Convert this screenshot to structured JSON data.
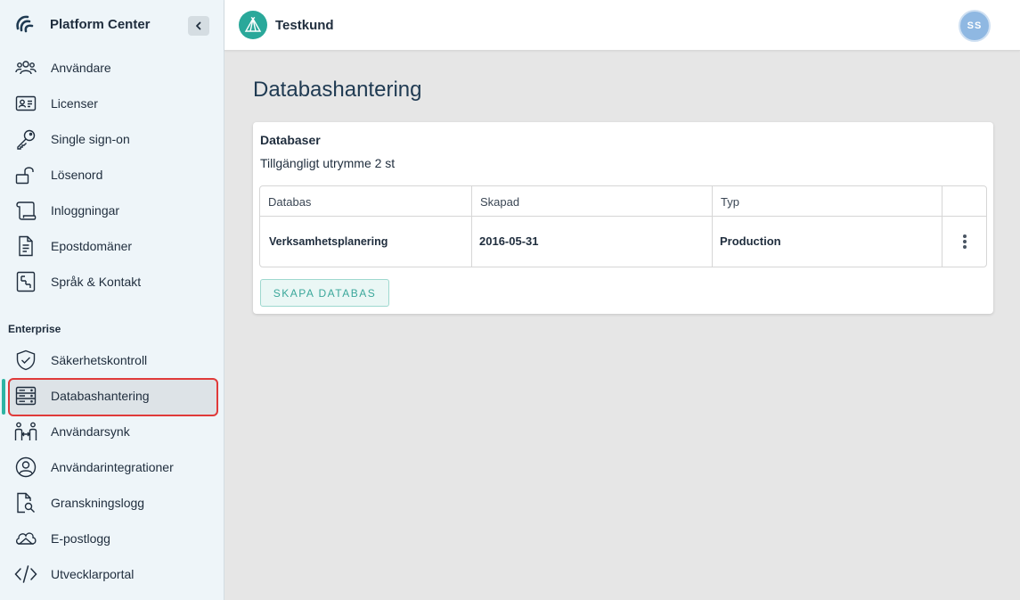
{
  "app": {
    "title": "Platform Center"
  },
  "header": {
    "tenant_name": "Testkund",
    "avatar_initials": "SS"
  },
  "sidebar": {
    "items": [
      {
        "label": "Användare",
        "icon": "users-icon"
      },
      {
        "label": "Licenser",
        "icon": "id-card-icon"
      },
      {
        "label": "Single sign-on",
        "icon": "key-icon"
      },
      {
        "label": "Lösenord",
        "icon": "unlock-icon"
      },
      {
        "label": "Inloggningar",
        "icon": "scroll-icon"
      },
      {
        "label": "Epostdomäner",
        "icon": "document-icon"
      },
      {
        "label": "Språk & Kontakt",
        "icon": "settings-panel-icon"
      }
    ],
    "section_label": "Enterprise",
    "enterprise_items": [
      {
        "label": "Säkerhetskontroll",
        "icon": "shield-icon"
      },
      {
        "label": "Databashantering",
        "icon": "database-icon",
        "active": true
      },
      {
        "label": "Användarsynk",
        "icon": "user-sync-icon"
      },
      {
        "label": "Användarintegrationer",
        "icon": "user-circle-icon"
      },
      {
        "label": "Granskningslogg",
        "icon": "file-search-icon"
      },
      {
        "label": "E-postlogg",
        "icon": "mail-cloud-icon"
      },
      {
        "label": "Utvecklarportal",
        "icon": "code-icon"
      }
    ]
  },
  "main": {
    "page_title": "Databashantering",
    "card": {
      "title": "Databaser",
      "subtitle": "Tillgängligt utrymme 2 st",
      "columns": [
        "Databas",
        "Skapad",
        "Typ"
      ],
      "rows": [
        {
          "name": "Verksamhetsplanering",
          "created": "2016-05-31",
          "type": "Production"
        }
      ],
      "create_button": "SKAPA DATABAS"
    }
  },
  "colors": {
    "accent": "#2fb4a4",
    "highlight_border": "#e03a3a",
    "sidebar_bg": "#eef5f9"
  }
}
